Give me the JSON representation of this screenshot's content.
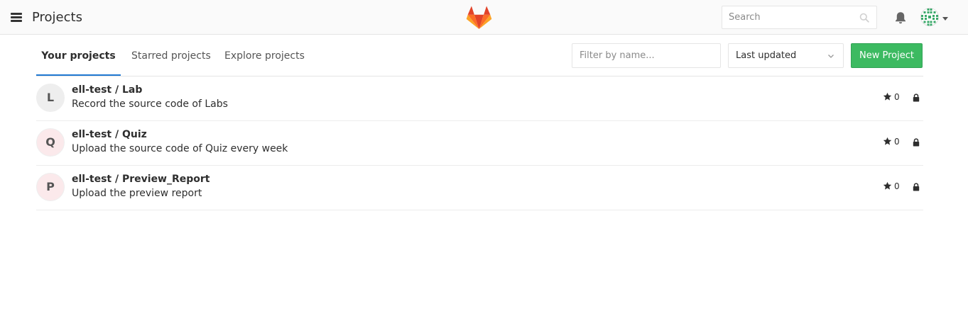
{
  "navbar": {
    "title": "Projects",
    "menu_icon": "hamburger-icon",
    "logo_icon": "gitlab-tanuki-logo",
    "search_placeholder": "Search",
    "search_icon": "search-icon",
    "notifications_icon": "bell-icon",
    "avatar_icon": "user-avatar-identicon",
    "caret_icon": "caret-down-icon"
  },
  "tabs": [
    {
      "label": "Your projects",
      "active": true
    },
    {
      "label": "Starred projects",
      "active": false
    },
    {
      "label": "Explore projects",
      "active": false
    }
  ],
  "filter": {
    "placeholder": "Filter by name..."
  },
  "sort": {
    "selected": "Last updated",
    "icon": "chevron-down-icon"
  },
  "new_project_button": "New Project",
  "colors": {
    "accent_blue": "#1f78d1",
    "new_button_green": "#3cba61",
    "avatar_L_bg": "#eeeeee",
    "avatar_Q_bg": "#fbe9eb",
    "avatar_P_bg": "#fbe9eb"
  },
  "projects": [
    {
      "initial": "L",
      "name": "ell-test / Lab",
      "description": "Record the source code of Labs",
      "stars": "0",
      "visibility_icon": "lock-icon"
    },
    {
      "initial": "Q",
      "name": "ell-test / Quiz",
      "description": "Upload the source code of Quiz every week",
      "stars": "0",
      "visibility_icon": "lock-icon"
    },
    {
      "initial": "P",
      "name": "ell-test / Preview_Report",
      "description": "Upload the preview report",
      "stars": "0",
      "visibility_icon": "lock-icon"
    }
  ]
}
